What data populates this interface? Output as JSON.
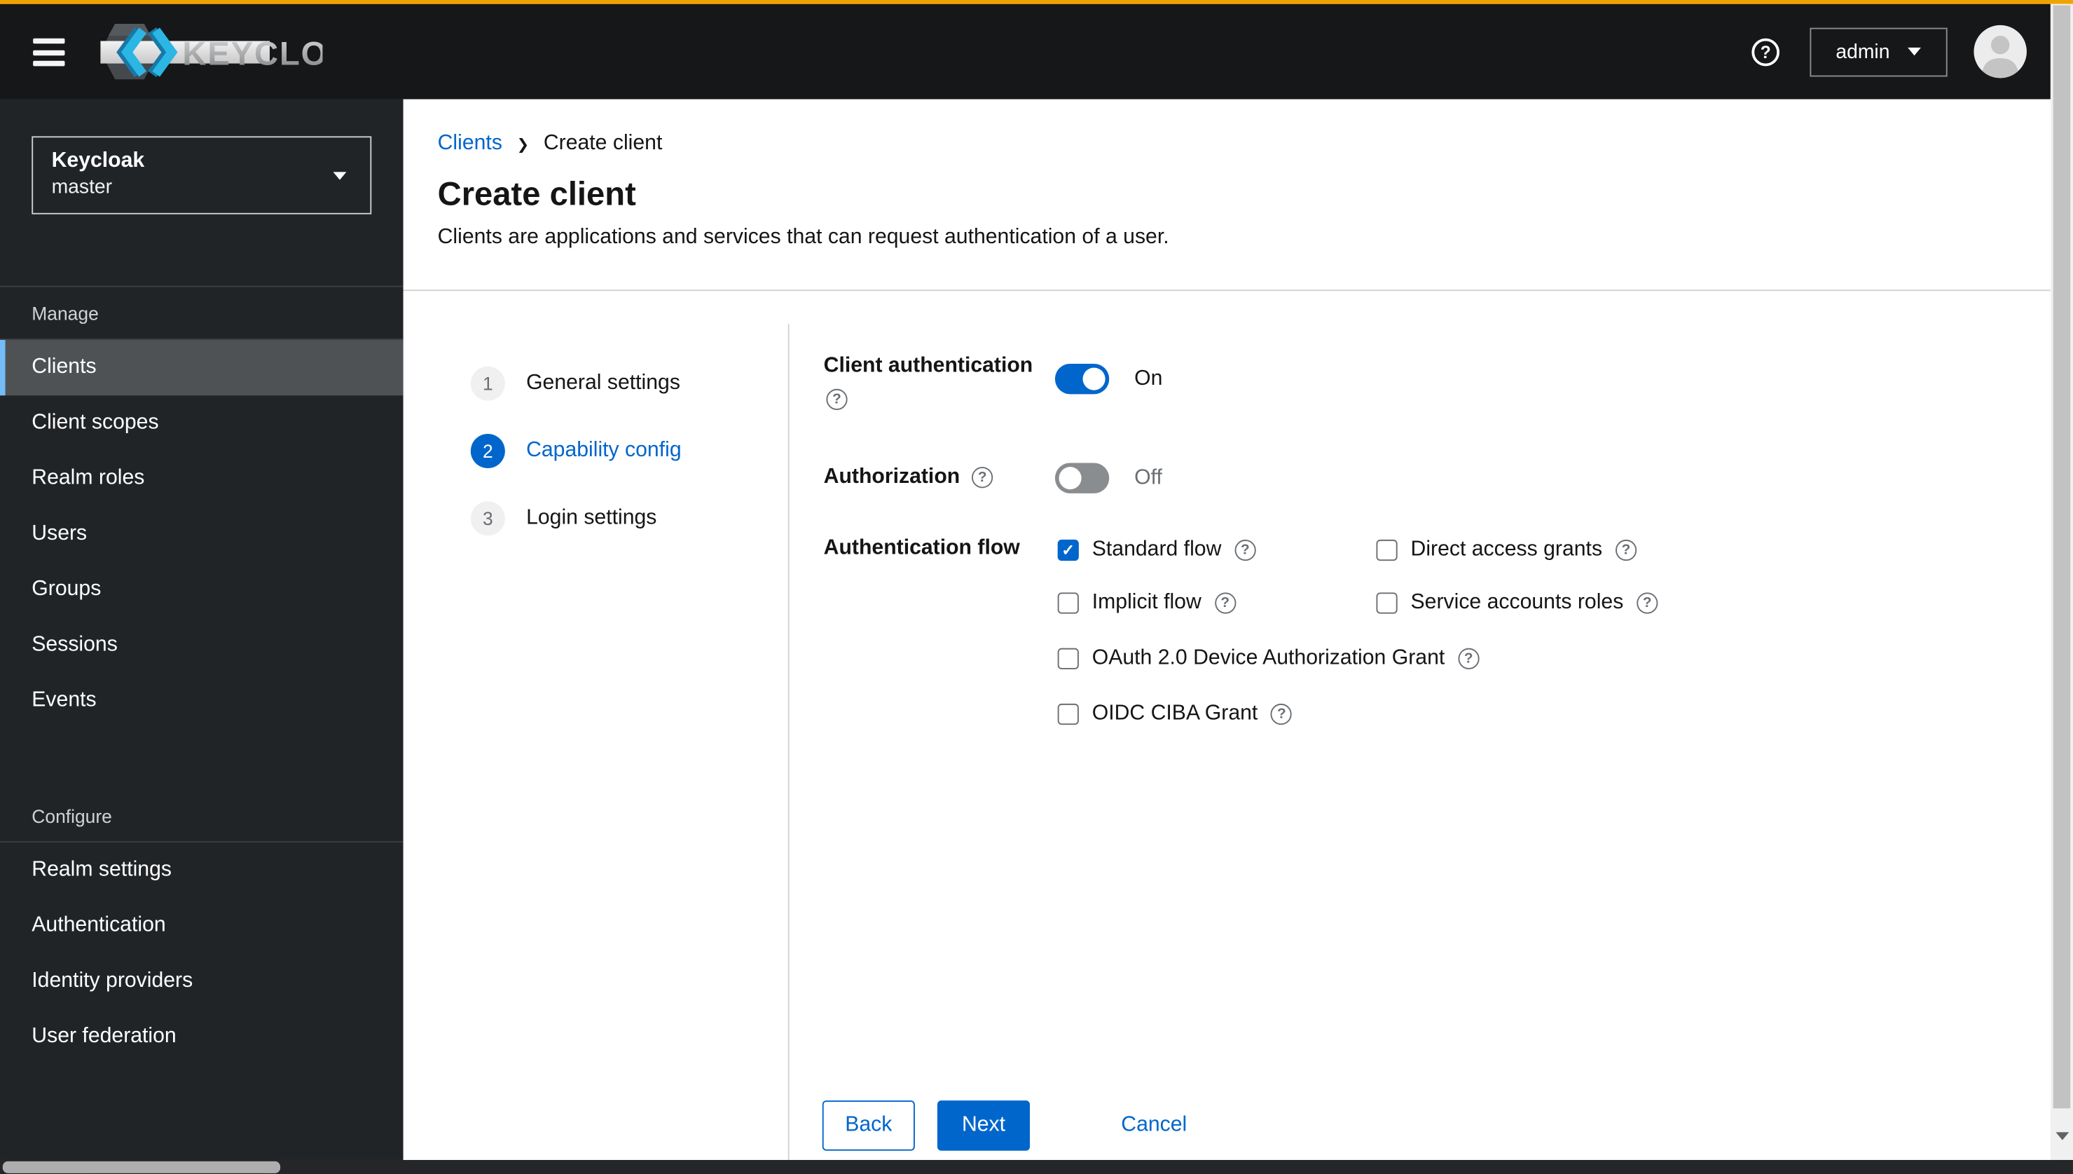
{
  "masthead": {
    "brand_text": "KEYCLOAK",
    "user": {
      "label": "admin"
    }
  },
  "sidebar": {
    "realm_selector": {
      "title": "Keycloak",
      "subtitle": "master"
    },
    "sections": [
      {
        "label": "Manage",
        "items": [
          {
            "label": "Clients",
            "selected": true
          },
          {
            "label": "Client scopes",
            "selected": false
          },
          {
            "label": "Realm roles",
            "selected": false
          },
          {
            "label": "Users",
            "selected": false
          },
          {
            "label": "Groups",
            "selected": false
          },
          {
            "label": "Sessions",
            "selected": false
          },
          {
            "label": "Events",
            "selected": false
          }
        ]
      },
      {
        "label": "Configure",
        "items": [
          {
            "label": "Realm settings",
            "selected": false
          },
          {
            "label": "Authentication",
            "selected": false
          },
          {
            "label": "Identity providers",
            "selected": false
          },
          {
            "label": "User federation",
            "selected": false
          }
        ]
      }
    ]
  },
  "breadcrumb": [
    {
      "label": "Clients",
      "current": false
    },
    {
      "label": "Create client",
      "current": true
    }
  ],
  "page": {
    "title": "Create client",
    "description": "Clients are applications and services that can request authentication of a user."
  },
  "wizard": {
    "steps": [
      {
        "number": "1",
        "label": "General settings",
        "active": false
      },
      {
        "number": "2",
        "label": "Capability config",
        "active": true
      },
      {
        "number": "3",
        "label": "Login settings",
        "active": false
      }
    ],
    "form": {
      "client_authentication": {
        "label": "Client authentication",
        "state": "On",
        "on": true
      },
      "authorization": {
        "label": "Authorization",
        "state": "Off",
        "on": false
      },
      "authentication_flow": {
        "label": "Authentication flow",
        "columns": [
          [
            {
              "label": "Standard flow",
              "checked": true
            },
            {
              "label": "Implicit flow",
              "checked": false
            },
            {
              "label": "OAuth 2.0 Device Authorization Grant",
              "checked": false
            },
            {
              "label": "OIDC CIBA Grant",
              "checked": false
            }
          ],
          [
            {
              "label": "Direct access grants",
              "checked": false
            },
            {
              "label": "Service accounts roles",
              "checked": false
            }
          ]
        ]
      }
    },
    "actions": {
      "back": "Back",
      "next": "Next",
      "cancel": "Cancel"
    }
  },
  "colors": {
    "accent": "#0066cc",
    "masthead_strip": "#f0a300",
    "nav_selected_bg": "#4f5255",
    "nav_selected_accent": "#73bcf7"
  }
}
